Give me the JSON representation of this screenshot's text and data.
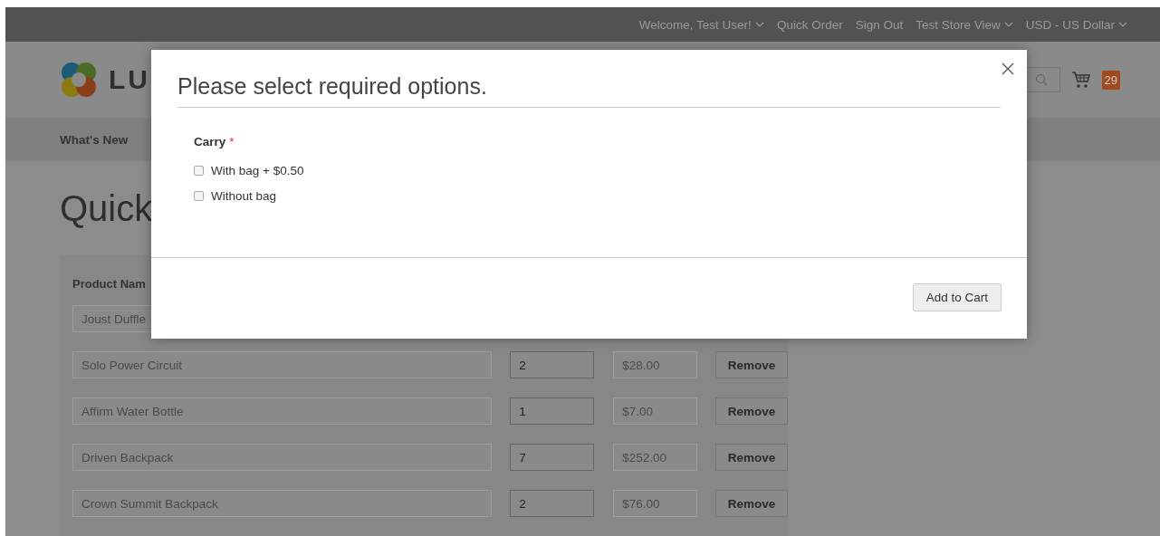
{
  "top_bar": {
    "links": [
      {
        "label": "Welcome, Test User!",
        "dropdown": true
      },
      {
        "label": "Quick Order",
        "dropdown": false
      },
      {
        "label": "Sign Out",
        "dropdown": false
      },
      {
        "label": "Test Store View",
        "dropdown": true
      },
      {
        "label": "USD - US Dollar",
        "dropdown": true
      }
    ]
  },
  "header": {
    "logo_text": "LU",
    "cart_count": "29"
  },
  "nav": {
    "items": [
      "What's New"
    ]
  },
  "page_title": "Quick",
  "table": {
    "column_1": "Product Nam",
    "rows": [
      {
        "product": "Joust Duffle"
      },
      {
        "product": "Solo Power Circuit",
        "qty": "2",
        "price": "$28.00",
        "action": "Remove"
      },
      {
        "product": "Affirm Water Bottle",
        "qty": "1",
        "price": "$7.00",
        "action": "Remove"
      },
      {
        "product": "Driven Backpack",
        "qty": "7",
        "price": "$252.00",
        "action": "Remove"
      },
      {
        "product": "Crown Summit Backpack",
        "qty": "2",
        "price": "$76.00",
        "action": "Remove"
      }
    ]
  },
  "modal": {
    "title": "Please select required options.",
    "option": {
      "label": "Carry",
      "required": true,
      "required_mark": "*",
      "choices": [
        {
          "label": "With bag + $0.50",
          "checked": false
        },
        {
          "label": "Without bag",
          "checked": false
        }
      ]
    },
    "button": "Add to Cart"
  }
}
